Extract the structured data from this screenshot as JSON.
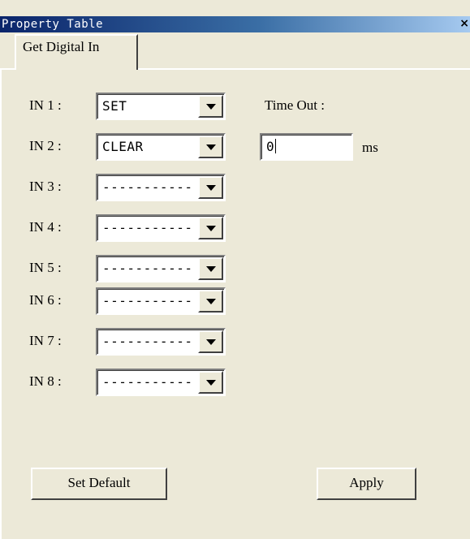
{
  "window": {
    "title": "Property Table",
    "close_glyph": "×"
  },
  "tabs": [
    {
      "label": "Get Digital In"
    }
  ],
  "inputs": [
    {
      "label": "IN 1 :",
      "value": "SET"
    },
    {
      "label": "IN 2 :",
      "value": "CLEAR"
    },
    {
      "label": "IN 3 :",
      "value": "-----------"
    },
    {
      "label": "IN 4 :",
      "value": "-----------"
    },
    {
      "label": "IN 5 :",
      "value": "-----------"
    },
    {
      "label": "IN 6 :",
      "value": "-----------"
    },
    {
      "label": "IN 7 :",
      "value": "-----------"
    },
    {
      "label": "IN 8 :",
      "value": "-----------"
    }
  ],
  "timeout": {
    "label": "Time Out :",
    "value": "0",
    "unit": "ms"
  },
  "buttons": {
    "set_default": "Set Default",
    "apply": "Apply"
  },
  "colors": {
    "titlebar_start": "#0a246a",
    "titlebar_end": "#a6caf0",
    "face": "#ece9d8"
  }
}
